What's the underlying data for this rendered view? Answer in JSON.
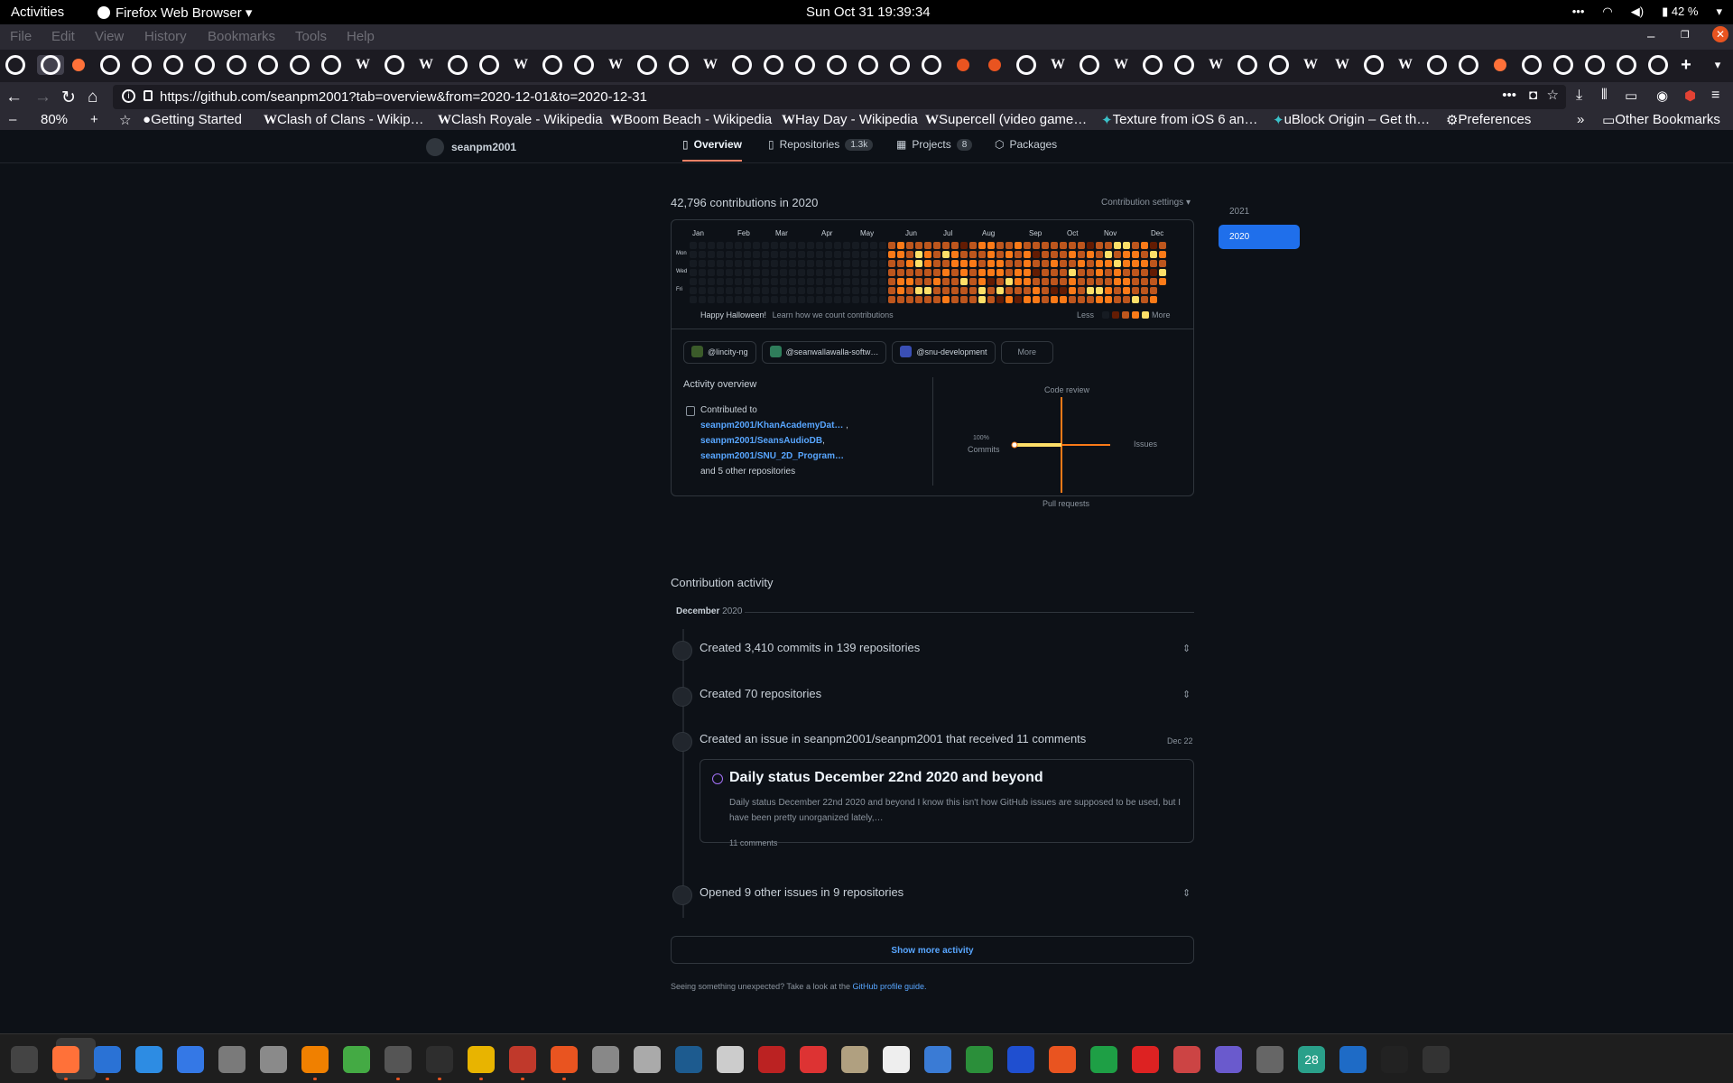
{
  "system": {
    "activities": "Activities",
    "app_name": "Firefox Web Browser",
    "clock": "Sun Oct 31  19:39:34",
    "battery": "42 %"
  },
  "menu": [
    "File",
    "Edit",
    "View",
    "History",
    "Bookmarks",
    "Tools",
    "Help"
  ],
  "browser": {
    "url": "https://github.com/seanpm2001?tab=overview&from=2020-12-01&to=2020-12-31",
    "zoom": "80%",
    "tabs": [
      "github",
      "github",
      "firefox",
      "github",
      "github",
      "github",
      "github",
      "github",
      "github",
      "github",
      "github",
      "wikipedia",
      "github",
      "wikipedia",
      "github",
      "github",
      "wikipedia",
      "github",
      "github",
      "wikipedia",
      "github",
      "github",
      "wikipedia",
      "github",
      "github",
      "github",
      "github",
      "github",
      "github",
      "github",
      "ubuntu",
      "ubuntu",
      "github",
      "wikipedia",
      "github",
      "wikipedia",
      "github",
      "github",
      "wikipedia",
      "github",
      "github",
      "wikipedia",
      "wikipedia",
      "github",
      "wikipedia",
      "github",
      "github",
      "firefox",
      "github",
      "github",
      "github",
      "github",
      "github"
    ],
    "bookmarks": [
      "Getting Started",
      "Clash of Clans - Wikip…",
      "Clash Royale - Wikipedia",
      "Boom Beach - Wikipedia",
      "Hay Day - Wikipedia",
      "Supercell (video game…",
      "Texture from iOS 6 an…",
      "uBlock Origin – Get th…",
      "Preferences"
    ],
    "other_bookmarks": "Other Bookmarks"
  },
  "profile": {
    "username": "seanpm2001",
    "tabs": [
      {
        "label": "Overview",
        "count": ""
      },
      {
        "label": "Repositories",
        "count": "1.3k"
      },
      {
        "label": "Projects",
        "count": "8"
      },
      {
        "label": "Packages",
        "count": ""
      }
    ]
  },
  "contributions": {
    "title": "42,796 contributions in 2020",
    "settings": "Contribution settings",
    "years": [
      "2021",
      "2020"
    ],
    "selected_year": "2020",
    "months": [
      "Jan",
      "Feb",
      "Mar",
      "Apr",
      "May",
      "Jun",
      "Jul",
      "Aug",
      "Sep",
      "Oct",
      "Nov",
      "Dec"
    ],
    "days": [
      "Mon",
      "Wed",
      "Fri"
    ],
    "note": "Happy Halloween!",
    "learn": "Learn how we count contributions",
    "less": "Less",
    "more": "More",
    "colors": [
      "#161b22",
      "#631c03",
      "#bd561d",
      "#fa7a18",
      "#fddf68"
    ]
  },
  "orgs": [
    {
      "name": "@lincity-ng",
      "color": "#3b5b2a"
    },
    {
      "name": "@seanwallawalla-softw…",
      "color": "#2f7d5b"
    },
    {
      "name": "@snu-development",
      "color": "#3a4fb5"
    }
  ],
  "orgs_more": "More",
  "activity_overview": {
    "title": "Activity overview",
    "contributed_to": "Contributed to",
    "repos": [
      "seanpm2001/KhanAcademyDat…",
      "seanpm2001/SeansAudioDB",
      "seanpm2001/SNU_2D_Program…"
    ],
    "others": "and 5 other repositories",
    "radar": {
      "code_review": "Code review",
      "issues": "Issues",
      "pull_requests": "Pull requests",
      "commits": "Commits",
      "commits_pct": "100%",
      "commits_value": 100
    }
  },
  "activity": {
    "title": "Contribution activity",
    "month": "December",
    "year": "2020",
    "items": [
      "Created 3,410 commits in 139 repositories",
      "Created 70 repositories",
      "Created an issue in seanpm2001/seanpm2001 that received 11 comments",
      "Opened 9 other issues in 9 repositories"
    ],
    "issue_date": "Dec 22",
    "issue": {
      "title": "Daily status December 22nd 2020 and beyond",
      "body": "Daily status December 22nd 2020 and beyond I know this isn't how GitHub issues are supposed to be used, but I have been pretty unorganized lately,…",
      "comments": "11 comments"
    },
    "show_more": "Show more activity",
    "footnote_pre": "Seeing something unexpected? Take a look at the",
    "footnote_link": "GitHub profile guide."
  },
  "dock": [
    "system-monitor",
    "firefox",
    "libreoffice-writer",
    "help",
    "text-editor",
    "files",
    "settings",
    "vlc",
    "puzzle",
    "software",
    "terminal",
    "calculator",
    "charts",
    "app-center",
    "search",
    "disk",
    "inkscape",
    "scan",
    "text",
    "pdf",
    "archive",
    "font",
    "tasks",
    "vim",
    "virtualbox",
    "updater",
    "spreadsheet",
    "alert",
    "game",
    "camera",
    "gimp",
    "calendar",
    "thunderbird",
    "music",
    "app-grid"
  ],
  "dock_calendar_day": "28"
}
